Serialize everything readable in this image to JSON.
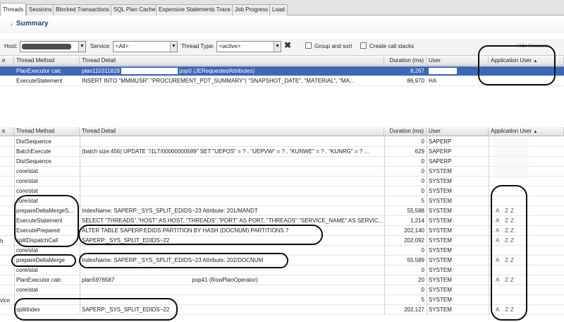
{
  "tabs": [
    "Threads",
    "Sessions",
    "Blocked Transactions",
    "SQL Plan Cache",
    "Expensive Statements Trace",
    "Job Progress",
    "Load"
  ],
  "summary": {
    "title": "Summary",
    "arrow": "›"
  },
  "filters": {
    "host_label": "Host:",
    "service_label": "Service:",
    "service_value": "<All>",
    "thread_type_label": "Thread Type:",
    "thread_type_value": "<active>",
    "group_and_sort": "Group and sort",
    "create_call_stacks": "Create call stacks",
    "hide_sessions": "Hide Sessions"
  },
  "columns": {
    "thread_method": "Thread Method",
    "thread_detail": "Thread Detail",
    "duration": "Duration (ms)",
    "user": "User",
    "app_user": "Application User",
    "sort_indicator": "▲"
  },
  "top_grid": {
    "rows": [
      {
        "method": "PlanExecutor calc",
        "detail": "plan110311828",
        "detail_tail": "pop0 (JERequestedAttributes)",
        "duration": "8,267",
        "user": "",
        "selected": true
      },
      {
        "method": "ExecuteStatement",
        "detail": "INSERT INTO \"MMMUSR\".\"PROCUREMENT_PDT_SUMMARY\"(    \"SNAPSHOT_DATE\",    \"MATERIAL\",    \"MA...",
        "detail_tail": "",
        "duration": "86,970",
        "user": "HA",
        "selected": false
      }
    ]
  },
  "bottom_grid": {
    "first_col": "e",
    "rows": [
      {
        "method": "DistSequence",
        "detail": "",
        "duration": "0",
        "user": "SAPERP",
        "app": ""
      },
      {
        "method": "BatchExecute",
        "detail": "(batch size:456) UPDATE \"/1LT/00000000589\" SET \"UEPOS\" = ? , \"UEPVW\" = ? , \"KUNWE\" = ? , \"KUNRG\" = ? ...",
        "duration": "629",
        "user": "SAPERP",
        "app": ""
      },
      {
        "method": "DistSequence",
        "detail": "",
        "duration": "0",
        "user": "SAPERP",
        "app": ""
      },
      {
        "method": "core/stat",
        "detail": "",
        "duration": "0",
        "user": "SYSTEM",
        "app": ""
      },
      {
        "method": "core/stat",
        "detail": "",
        "duration": "0",
        "user": "SYSTEM",
        "app": ""
      },
      {
        "method": "core/stat",
        "detail": "",
        "duration": "0",
        "user": "SYSTEM",
        "app": ""
      },
      {
        "method": "core/stat",
        "detail": "",
        "duration": "5",
        "user": "SYSTEM",
        "app": ""
      },
      {
        "method": "prepareDeltaMergeS...",
        "detail": "IndexName: SAPERP:_SYS_SPLIT_EDIDS~23 Attribute: 201/MANDT",
        "duration": "55,588",
        "user": "SYSTEM",
        "app": "A  ZZ"
      },
      {
        "method": "ExecuteStatement",
        "detail": "SELECT \"THREADS\".\"HOST\" AS HOST, \"THREADS\".\"PORT\" AS PORT, \"THREADS\".\"SERVICE_NAME\" AS SERVIC...",
        "duration": "1,214",
        "user": "SYSTEM",
        "app": "A  ZZ"
      },
      {
        "method": "ExecutePrepared",
        "detail": "ALTER TABLE SAPERP.EDIDS PARTITION BY HASH (DOCNUM) PARTITIONS 7",
        "duration": "202,140",
        "user": "SYSTEM",
        "app": "A  ZZ"
      },
      {
        "method": "splitDispatchCall",
        "detail": "SAPERP:_SYS_SPLIT_EDIDS~22",
        "duration": "202,092",
        "user": "SYSTEM",
        "app": "A  ZZ"
      },
      {
        "method": "core/stat",
        "detail": "",
        "duration": "0",
        "user": "SYSTEM",
        "app": ""
      },
      {
        "method": "prepareDeltaMerge",
        "detail": "IndexName: SAPERP:_SYS_SPLIT_EDIDS~23 Attribute: 202/DOCNUM",
        "duration": "55,589",
        "user": "SYSTEM",
        "app": "A  ZZ"
      },
      {
        "method": "core/stat",
        "detail": "",
        "duration": "0",
        "user": "SYSTEM",
        "app": ""
      },
      {
        "method": "PlanExecutor calc",
        "detail": "plan5976587",
        "detail_tail": "pop41 (RowPlanOperator)",
        "duration": "20",
        "user": "SYSTEM",
        "app": "A  ZZ"
      },
      {
        "method": "core/stat",
        "detail": "",
        "duration": "0",
        "user": "SYSTEM",
        "app": ""
      },
      {
        "method": "",
        "detail": "",
        "duration": "5",
        "user": "SYSTEM",
        "app": ""
      },
      {
        "method": "splitIndex",
        "detail": "SAPERP:_SYS_SPLIT_EDIDS~22",
        "duration": "202,127",
        "user": "SYSTEM",
        "app": "A  ZZ"
      }
    ]
  },
  "side_labels": {
    "vice": "vice"
  },
  "colors": {
    "selection": "#3c68b8",
    "accent": "#23457e",
    "ink": "#0d0d0d"
  }
}
